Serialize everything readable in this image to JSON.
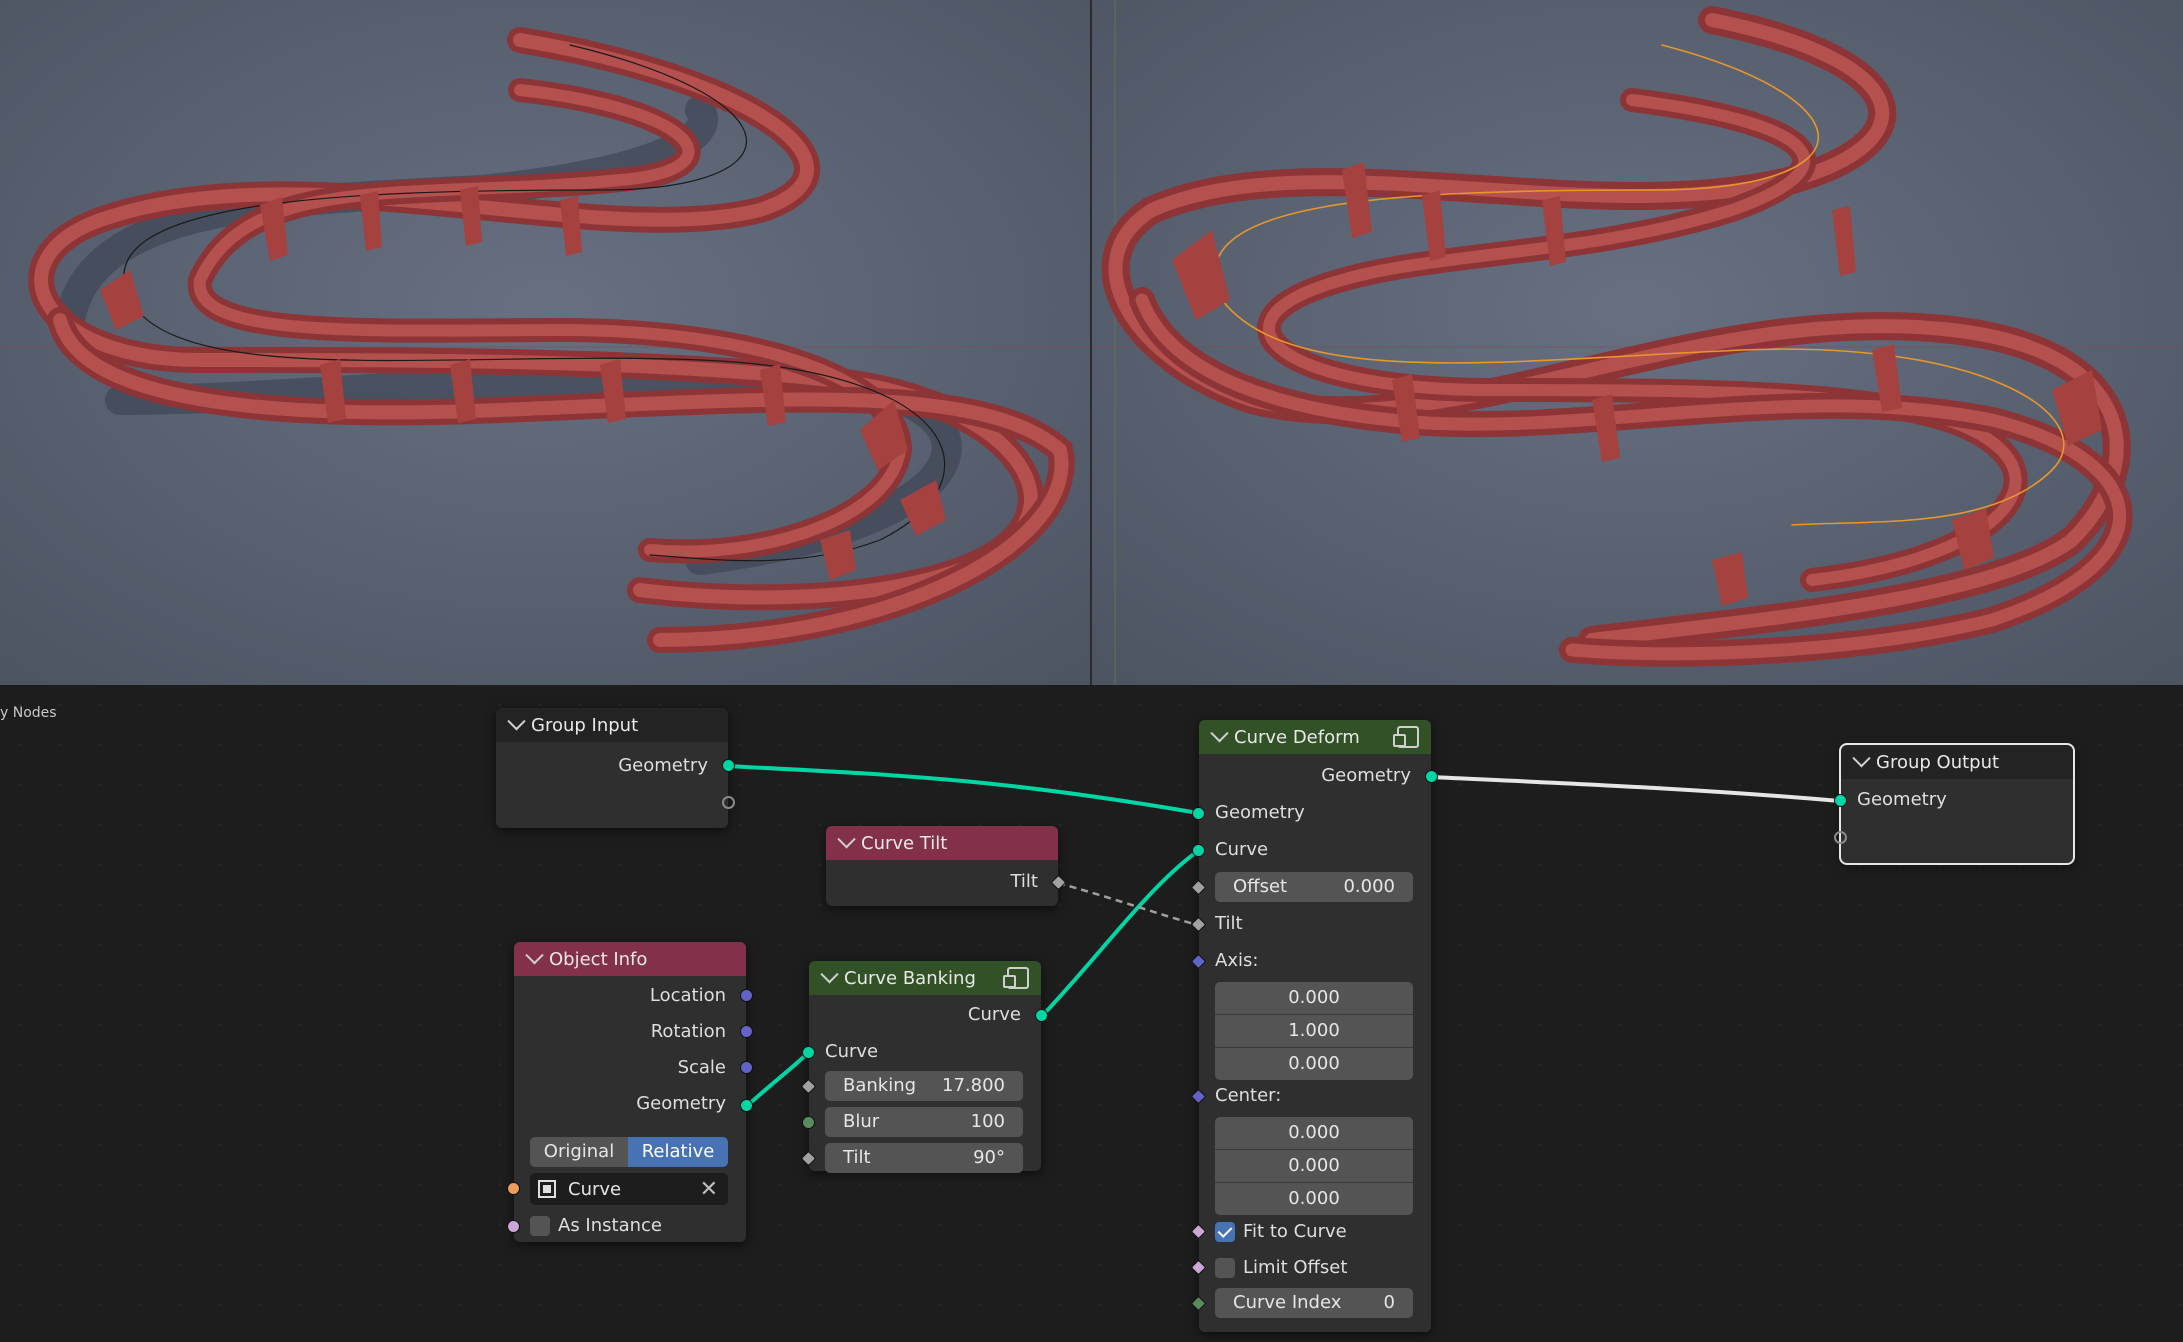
{
  "node_editor": {
    "label": "y Nodes",
    "nodes": {
      "group_input": {
        "title": "Group Input",
        "outputs": {
          "geometry": "Geometry"
        }
      },
      "object_info": {
        "title": "Object Info",
        "outputs": {
          "location": "Location",
          "rotation": "Rotation",
          "scale": "Scale",
          "geometry": "Geometry"
        },
        "mode_original": "Original",
        "mode_relative": "Relative",
        "mode_selected": "Relative",
        "object_value": "Curve",
        "as_instance_label": "As Instance",
        "as_instance_checked": false
      },
      "curve_tilt": {
        "title": "Curve Tilt",
        "outputs": {
          "tilt": "Tilt"
        }
      },
      "curve_banking": {
        "title": "Curve Banking",
        "outputs": {
          "curve": "Curve"
        },
        "inputs": {
          "curve": "Curve"
        },
        "fields": {
          "banking_label": "Banking",
          "banking_value": "17.800",
          "blur_label": "Blur",
          "blur_value": "100",
          "tilt_label": "Tilt",
          "tilt_value": "90°"
        }
      },
      "curve_deform": {
        "title": "Curve Deform",
        "outputs": {
          "geometry": "Geometry"
        },
        "inputs": {
          "geometry": "Geometry",
          "curve": "Curve",
          "offset_label": "Offset",
          "offset_value": "0.000",
          "tilt": "Tilt",
          "axis_label": "Axis:",
          "axis_values": [
            "0.000",
            "1.000",
            "0.000"
          ],
          "center_label": "Center:",
          "center_values": [
            "0.000",
            "0.000",
            "0.000"
          ],
          "fit_to_curve_label": "Fit to Curve",
          "fit_to_curve_checked": true,
          "limit_offset_label": "Limit Offset",
          "limit_offset_checked": false,
          "curve_index_label": "Curve Index",
          "curve_index_value": "0"
        }
      },
      "group_output": {
        "title": "Group Output",
        "inputs": {
          "geometry": "Geometry"
        }
      }
    },
    "colors": {
      "geometry_link": "#00d6a3",
      "input_header": "#83314a",
      "geometry_header": "#325126",
      "selection": "#4772b3"
    }
  }
}
